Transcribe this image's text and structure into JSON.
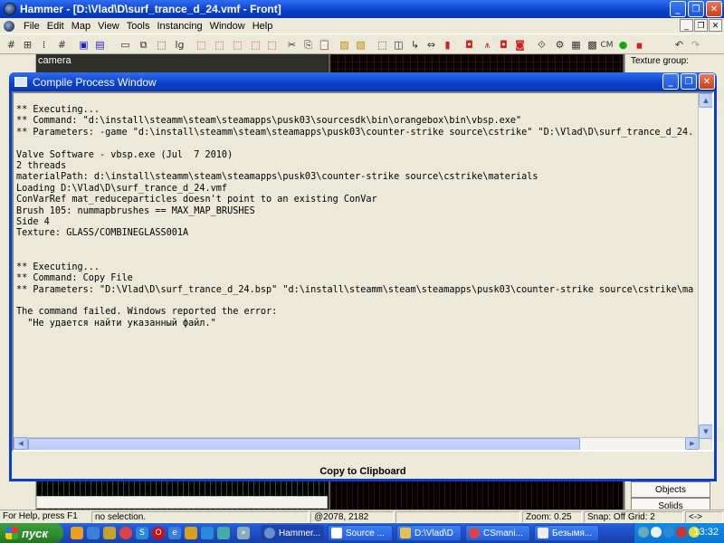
{
  "app": {
    "title": "Hammer - [D:\\Vlad\\D\\surf_trance_d_24.vmf - Front]"
  },
  "menu": [
    "File",
    "Edit",
    "Map",
    "View",
    "Tools",
    "Instancing",
    "Window",
    "Help"
  ],
  "viewport": {
    "camera_label": "camera"
  },
  "side_panel": {
    "texture_group_label": "Texture group:",
    "objects_button": "Objects",
    "solids_button": "Solids"
  },
  "compile_window": {
    "title": "Compile Process Window",
    "log_lines": [
      "** Executing...",
      "** Command: \"d:\\install\\steamm\\steam\\steamapps\\pusk03\\sourcesdk\\bin\\orangebox\\bin\\vbsp.exe\"",
      "** Parameters: -game \"d:\\install\\steamm\\steam\\steamapps\\pusk03\\counter-strike source\\cstrike\" \"D:\\Vlad\\D\\surf_trance_d_24.",
      "",
      "Valve Software - vbsp.exe (Jul  7 2010)",
      "2 threads",
      "materialPath: d:\\install\\steamm\\steam\\steamapps\\pusk03\\counter-strike source\\cstrike\\materials",
      "Loading D:\\Vlad\\D\\surf_trance_d_24.vmf",
      "ConVarRef mat_reduceparticles doesn't point to an existing ConVar",
      "Brush 105: nummapbrushes == MAX_MAP_BRUSHES",
      "Side 4",
      "Texture: GLASS/COMBINEGLASS001A",
      "",
      "",
      "** Executing...",
      "** Command: Copy File",
      "** Parameters: \"D:\\Vlad\\D\\surf_trance_d_24.bsp\" \"d:\\install\\steamm\\steam\\steamapps\\pusk03\\counter-strike source\\cstrike\\ma",
      "",
      "The command failed. Windows reported the error:",
      "  \"Не удается найти указанный файл.\""
    ],
    "copy_button": "Copy to Clipboard"
  },
  "status_bar": {
    "help": "For Help, press F1",
    "selection": "no selection.",
    "coords": "@2078, 2182",
    "zoom": "Zoom: 0.25",
    "snap": "Snap: Off Grid: 2",
    "nav": "<->"
  },
  "taskbar": {
    "start": "пуск",
    "items": [
      {
        "label": "Hammer...",
        "active": true
      },
      {
        "label": "Source ...",
        "active": false
      },
      {
        "label": "D:\\Vlad\\D",
        "active": false
      },
      {
        "label": "CSmani...",
        "active": false
      },
      {
        "label": "Безымя...",
        "active": false
      }
    ],
    "clock": "13:32"
  },
  "colors": {
    "xp_blue": "#0a3fc9",
    "taskbar_green": "#2f8c2f"
  }
}
